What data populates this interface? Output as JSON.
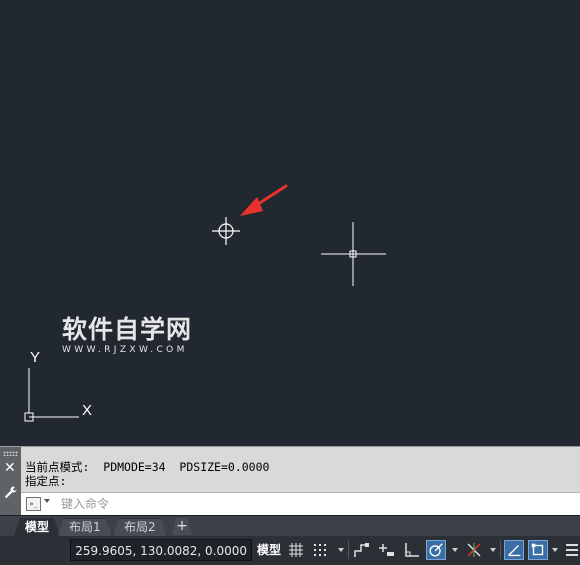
{
  "watermark": {
    "title": "软件自学网",
    "url": "WWW.RJZXW.COM"
  },
  "ucs": {
    "y_label": "Y",
    "x_label": "X"
  },
  "command_window": {
    "close_glyph": "✕",
    "history": [
      "当前点模式:  PDMODE=34  PDSIZE=0.0000",
      "指定点:"
    ],
    "prompt_glyph": "»_",
    "input_placeholder": "键入命令"
  },
  "tabs": {
    "items": [
      "模型",
      "布局1",
      "布局2"
    ],
    "active": "模型",
    "add_glyph": "+"
  },
  "status_bar": {
    "coordinates": "259.9605, 130.0082, 0.0000",
    "model_label": "模型",
    "icons": [
      "grid-icon",
      "snap-icon",
      "infer-constraints-icon",
      "dynamic-input-icon",
      "ortho-icon",
      "polar-tracking-icon",
      "isometric-drafting-icon",
      "object-snap-tracking-icon",
      "object-snap-icon",
      "customization-icon"
    ]
  },
  "colors": {
    "canvas_bg": "#212830",
    "arrow": "#e8322e",
    "crosshair": "#ffffff",
    "status_active": "#3a6ea5"
  }
}
